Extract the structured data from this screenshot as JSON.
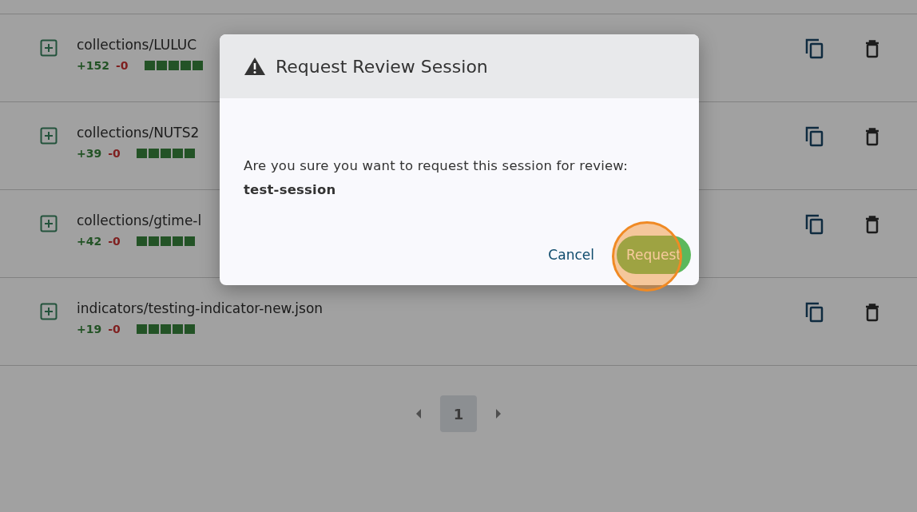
{
  "files": [
    {
      "name": "collections/LULUC",
      "added": "+152",
      "removed": "-0"
    },
    {
      "name": "collections/NUTS2",
      "added": "+39",
      "removed": "-0"
    },
    {
      "name": "collections/gtime-l",
      "added": "+42",
      "removed": "-0"
    },
    {
      "name": "indicators/testing-indicator-new.json",
      "added": "+19",
      "removed": "-0"
    }
  ],
  "pagination": {
    "pages": [
      {
        "label": "1",
        "selected": true
      }
    ]
  },
  "dialog": {
    "title": "Request Review Session",
    "message": "Are you sure you want to request this session for review: **test-session**",
    "buttons": [
      {
        "label": "Cancel",
        "kind": "text"
      },
      {
        "label": "Request",
        "kind": "primary"
      }
    ]
  }
}
